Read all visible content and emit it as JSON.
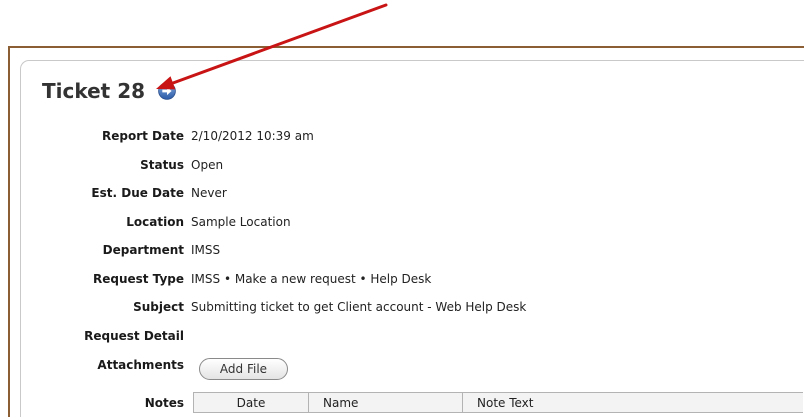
{
  "ticket": {
    "title": "Ticket 28",
    "icon": "circle-arrow-right-icon",
    "icon_color": "#3b6fb6"
  },
  "fields": [
    {
      "label": "Report Date",
      "value": "2/10/2012 10:39 am"
    },
    {
      "label": "Status",
      "value": "Open"
    },
    {
      "label": "Est. Due Date",
      "value": "Never"
    },
    {
      "label": "Location",
      "value": "Sample Location"
    },
    {
      "label": "Department",
      "value": "IMSS"
    },
    {
      "label": "Request Type",
      "value": "IMSS • Make a new request • Help Desk"
    },
    {
      "label": "Subject",
      "value": "Submitting ticket to get Client account - Web Help Desk"
    },
    {
      "label": "Request Detail"
    }
  ],
  "attachments": {
    "label": "Attachments",
    "add_button": "Add File"
  },
  "notes": {
    "label": "Notes",
    "columns": [
      "Date",
      "Name",
      "Note Text"
    ]
  },
  "annotation": {
    "arrow_color": "#c81414"
  },
  "colors": {
    "frame_border": "#8c5e34",
    "panel_border": "#c9c9c9",
    "title_text": "#333333"
  }
}
